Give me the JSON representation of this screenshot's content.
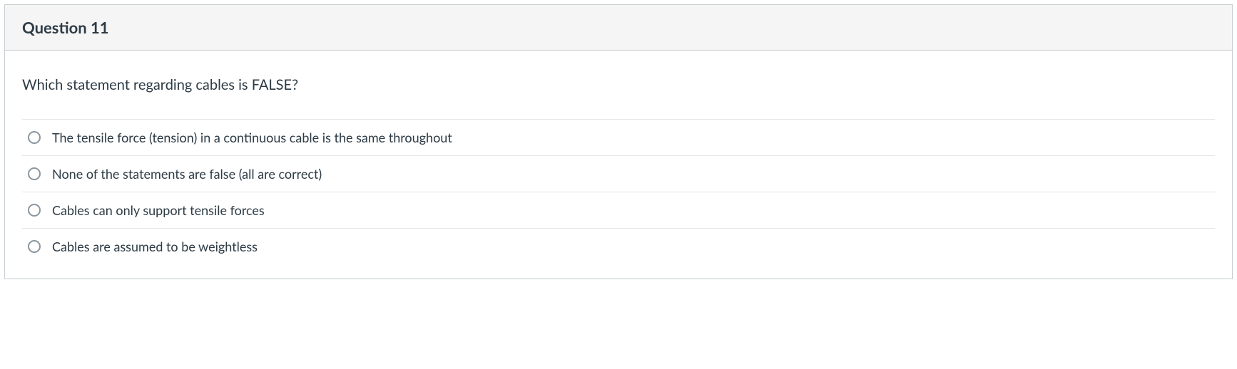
{
  "question": {
    "title": "Question 11",
    "prompt": "Which statement regarding cables is FALSE?",
    "answers": [
      {
        "label": "The tensile force (tension) in a continuous cable is the same throughout"
      },
      {
        "label": "None of the statements are false (all are correct)"
      },
      {
        "label": "Cables can only support tensile forces"
      },
      {
        "label": "Cables are assumed to be weightless"
      }
    ]
  }
}
